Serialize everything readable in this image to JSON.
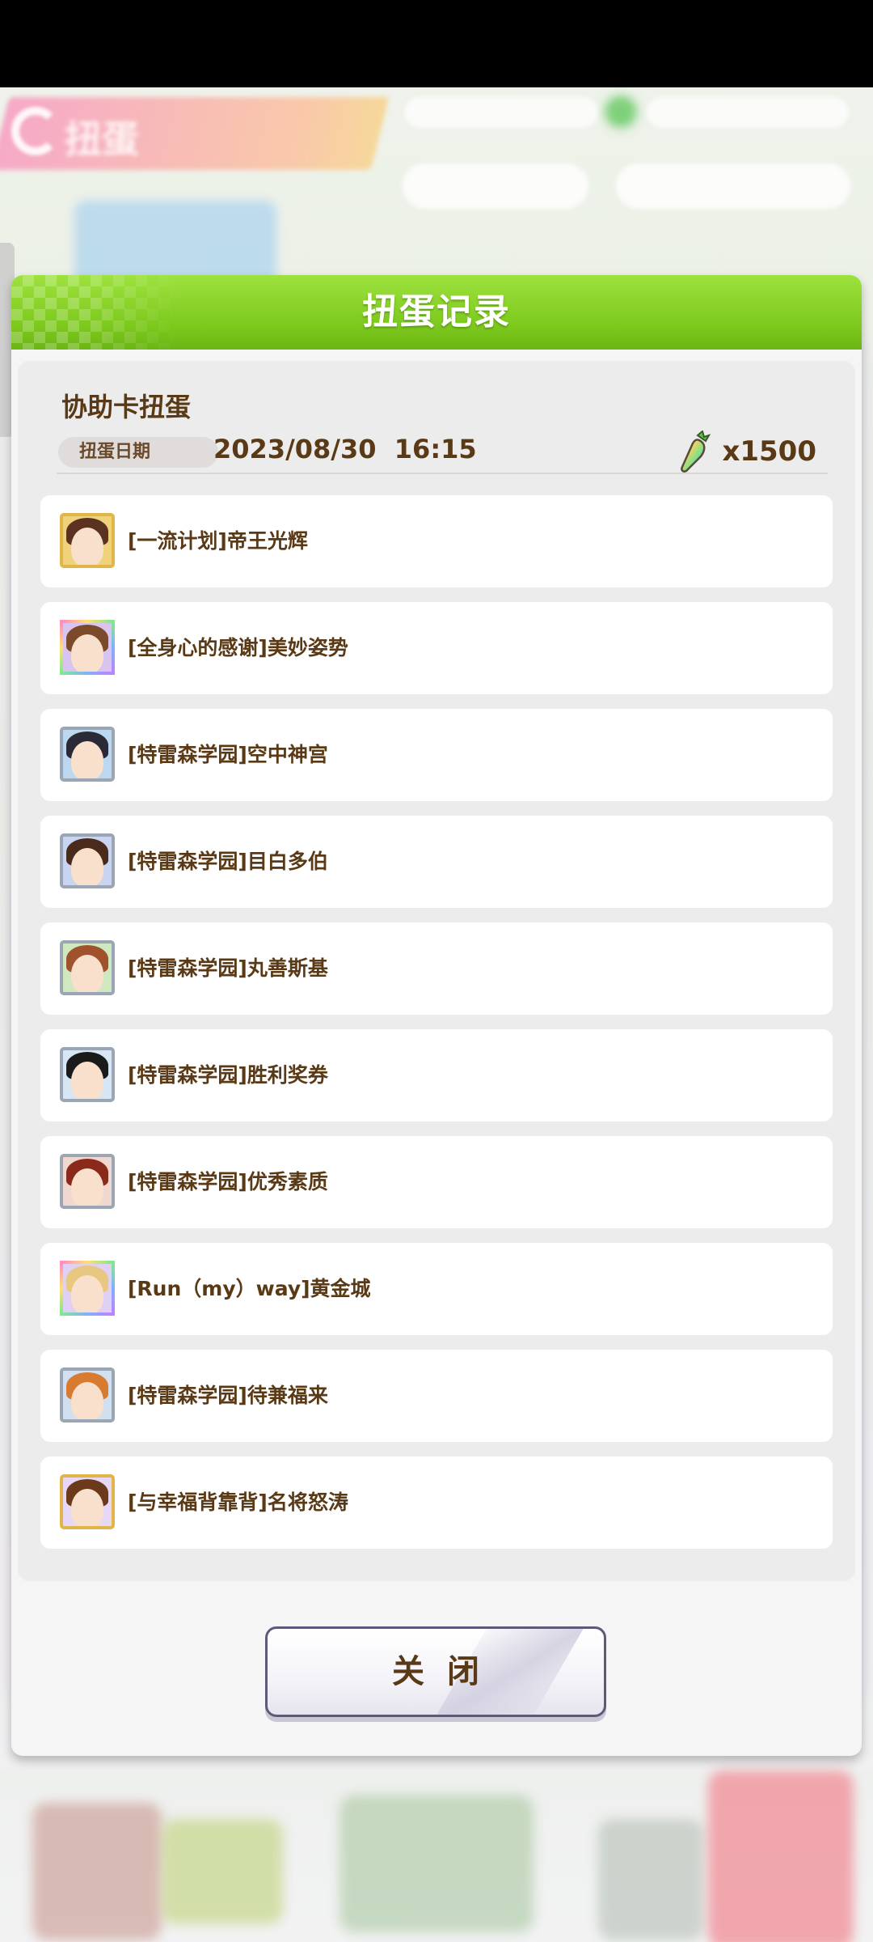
{
  "background": {
    "title": "扭蛋",
    "pills": [
      "",
      ""
    ],
    "currency": [
      "",
      ""
    ]
  },
  "modal": {
    "title": "扭蛋记录",
    "section_title": "协助卡扭蛋",
    "date_label": "扭蛋日期",
    "date_value": "2023/08/30  16:15",
    "cost_icon": "carrot-currency-icon",
    "cost_value": "x1500",
    "items": [
      {
        "label": "[一流计划]帝王光辉",
        "rarity": "gold",
        "hair": "#5b3222",
        "bg": "#f0d27a"
      },
      {
        "label": "[全身心的感谢]美妙姿势",
        "rarity": "rainbow",
        "hair": "#7a4a2a",
        "bg": "#d9c4f0"
      },
      {
        "label": "[特雷森学园]空中神宫",
        "rarity": "silver",
        "hair": "#2a2a36",
        "bg": "#bcd8f0"
      },
      {
        "label": "[特雷森学园]目白多伯",
        "rarity": "silver",
        "hair": "#4a2a1a",
        "bg": "#c8d4f0"
      },
      {
        "label": "[特雷森学园]丸善斯基",
        "rarity": "silver",
        "hair": "#a0522d",
        "bg": "#cfe8c0"
      },
      {
        "label": "[特雷森学园]胜利奖券",
        "rarity": "silver",
        "hair": "#1a1a1a",
        "bg": "#d6e6f4"
      },
      {
        "label": "[特雷森学园]优秀素质",
        "rarity": "silver",
        "hair": "#8a2a1a",
        "bg": "#f0d8d0"
      },
      {
        "label": "[Run（my）way]黄金城",
        "rarity": "rainbow",
        "hair": "#e8c880",
        "bg": "#e0d0f4"
      },
      {
        "label": "[特雷森学园]待兼福来",
        "rarity": "silver",
        "hair": "#d87a30",
        "bg": "#d0e0f0"
      },
      {
        "label": "[与幸福背靠背]名将怒涛",
        "rarity": "gold",
        "hair": "#6a3a1a",
        "bg": "#e8d8f8"
      }
    ],
    "close_label": "关闭"
  },
  "colors": {
    "header_green": "#7cc81c",
    "text_brown": "#5a3a16",
    "gold_frame": "#e2b548",
    "silver_frame": "#9aa6b4"
  }
}
